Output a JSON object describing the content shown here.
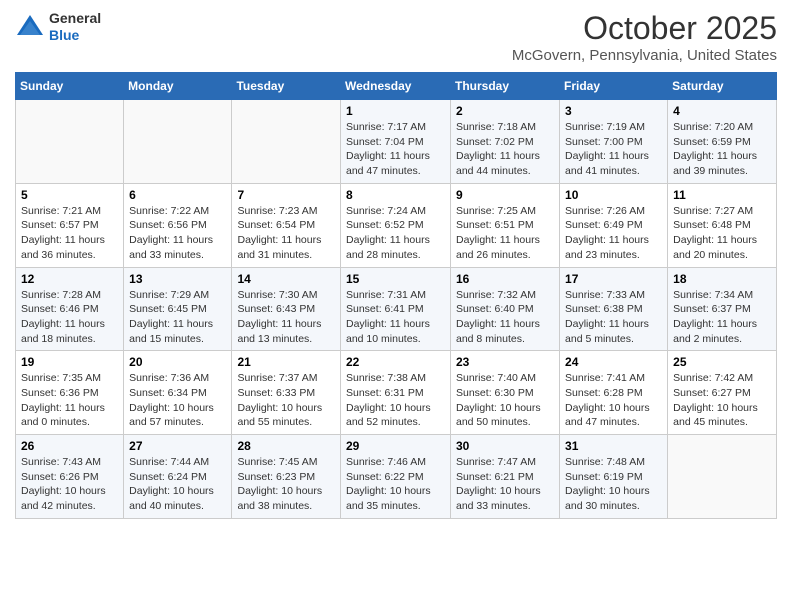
{
  "header": {
    "logo_line1": "General",
    "logo_line2": "Blue",
    "title": "October 2025",
    "subtitle": "McGovern, Pennsylvania, United States"
  },
  "days_of_week": [
    "Sunday",
    "Monday",
    "Tuesday",
    "Wednesday",
    "Thursday",
    "Friday",
    "Saturday"
  ],
  "weeks": [
    [
      {
        "day": "",
        "info": ""
      },
      {
        "day": "",
        "info": ""
      },
      {
        "day": "",
        "info": ""
      },
      {
        "day": "1",
        "info": "Sunrise: 7:17 AM\nSunset: 7:04 PM\nDaylight: 11 hours and 47 minutes."
      },
      {
        "day": "2",
        "info": "Sunrise: 7:18 AM\nSunset: 7:02 PM\nDaylight: 11 hours and 44 minutes."
      },
      {
        "day": "3",
        "info": "Sunrise: 7:19 AM\nSunset: 7:00 PM\nDaylight: 11 hours and 41 minutes."
      },
      {
        "day": "4",
        "info": "Sunrise: 7:20 AM\nSunset: 6:59 PM\nDaylight: 11 hours and 39 minutes."
      }
    ],
    [
      {
        "day": "5",
        "info": "Sunrise: 7:21 AM\nSunset: 6:57 PM\nDaylight: 11 hours and 36 minutes."
      },
      {
        "day": "6",
        "info": "Sunrise: 7:22 AM\nSunset: 6:56 PM\nDaylight: 11 hours and 33 minutes."
      },
      {
        "day": "7",
        "info": "Sunrise: 7:23 AM\nSunset: 6:54 PM\nDaylight: 11 hours and 31 minutes."
      },
      {
        "day": "8",
        "info": "Sunrise: 7:24 AM\nSunset: 6:52 PM\nDaylight: 11 hours and 28 minutes."
      },
      {
        "day": "9",
        "info": "Sunrise: 7:25 AM\nSunset: 6:51 PM\nDaylight: 11 hours and 26 minutes."
      },
      {
        "day": "10",
        "info": "Sunrise: 7:26 AM\nSunset: 6:49 PM\nDaylight: 11 hours and 23 minutes."
      },
      {
        "day": "11",
        "info": "Sunrise: 7:27 AM\nSunset: 6:48 PM\nDaylight: 11 hours and 20 minutes."
      }
    ],
    [
      {
        "day": "12",
        "info": "Sunrise: 7:28 AM\nSunset: 6:46 PM\nDaylight: 11 hours and 18 minutes."
      },
      {
        "day": "13",
        "info": "Sunrise: 7:29 AM\nSunset: 6:45 PM\nDaylight: 11 hours and 15 minutes."
      },
      {
        "day": "14",
        "info": "Sunrise: 7:30 AM\nSunset: 6:43 PM\nDaylight: 11 hours and 13 minutes."
      },
      {
        "day": "15",
        "info": "Sunrise: 7:31 AM\nSunset: 6:41 PM\nDaylight: 11 hours and 10 minutes."
      },
      {
        "day": "16",
        "info": "Sunrise: 7:32 AM\nSunset: 6:40 PM\nDaylight: 11 hours and 8 minutes."
      },
      {
        "day": "17",
        "info": "Sunrise: 7:33 AM\nSunset: 6:38 PM\nDaylight: 11 hours and 5 minutes."
      },
      {
        "day": "18",
        "info": "Sunrise: 7:34 AM\nSunset: 6:37 PM\nDaylight: 11 hours and 2 minutes."
      }
    ],
    [
      {
        "day": "19",
        "info": "Sunrise: 7:35 AM\nSunset: 6:36 PM\nDaylight: 11 hours and 0 minutes."
      },
      {
        "day": "20",
        "info": "Sunrise: 7:36 AM\nSunset: 6:34 PM\nDaylight: 10 hours and 57 minutes."
      },
      {
        "day": "21",
        "info": "Sunrise: 7:37 AM\nSunset: 6:33 PM\nDaylight: 10 hours and 55 minutes."
      },
      {
        "day": "22",
        "info": "Sunrise: 7:38 AM\nSunset: 6:31 PM\nDaylight: 10 hours and 52 minutes."
      },
      {
        "day": "23",
        "info": "Sunrise: 7:40 AM\nSunset: 6:30 PM\nDaylight: 10 hours and 50 minutes."
      },
      {
        "day": "24",
        "info": "Sunrise: 7:41 AM\nSunset: 6:28 PM\nDaylight: 10 hours and 47 minutes."
      },
      {
        "day": "25",
        "info": "Sunrise: 7:42 AM\nSunset: 6:27 PM\nDaylight: 10 hours and 45 minutes."
      }
    ],
    [
      {
        "day": "26",
        "info": "Sunrise: 7:43 AM\nSunset: 6:26 PM\nDaylight: 10 hours and 42 minutes."
      },
      {
        "day": "27",
        "info": "Sunrise: 7:44 AM\nSunset: 6:24 PM\nDaylight: 10 hours and 40 minutes."
      },
      {
        "day": "28",
        "info": "Sunrise: 7:45 AM\nSunset: 6:23 PM\nDaylight: 10 hours and 38 minutes."
      },
      {
        "day": "29",
        "info": "Sunrise: 7:46 AM\nSunset: 6:22 PM\nDaylight: 10 hours and 35 minutes."
      },
      {
        "day": "30",
        "info": "Sunrise: 7:47 AM\nSunset: 6:21 PM\nDaylight: 10 hours and 33 minutes."
      },
      {
        "day": "31",
        "info": "Sunrise: 7:48 AM\nSunset: 6:19 PM\nDaylight: 10 hours and 30 minutes."
      },
      {
        "day": "",
        "info": ""
      }
    ]
  ]
}
